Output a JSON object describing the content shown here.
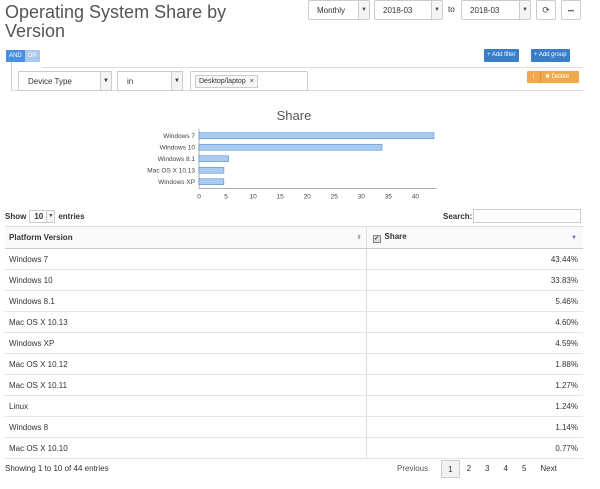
{
  "page": {
    "title": "Operating System Share by Version"
  },
  "controls": {
    "period": "Monthly",
    "from_date": "2018-03",
    "to_label": "to",
    "to_date": "2018-03",
    "refresh_icon": "refresh-icon",
    "more_icon": "ellipsis-icon",
    "more_label": "•••"
  },
  "filters": {
    "and_label": "AND",
    "or_label": "OR",
    "add_filter": "+ Add filter",
    "add_group": "+ Add group",
    "delete_label": "✖ Delete",
    "info_icon": "i",
    "field": "Device Type",
    "operator": "in",
    "value": "Desktop/laptop",
    "remove_x": "×"
  },
  "chart_data": {
    "type": "bar",
    "orientation": "horizontal",
    "title": "Share",
    "categories": [
      "Windows 7",
      "Windows 10",
      "Windows 8.1",
      "Mac OS X 10.13",
      "Windows XP"
    ],
    "values": [
      43.44,
      33.83,
      5.46,
      4.6,
      4.59
    ],
    "xlim": [
      0,
      44
    ],
    "xticks": [
      0,
      5,
      10,
      15,
      20,
      25,
      30,
      35,
      40
    ],
    "bar_color": "#a9cbf0",
    "bar_stroke": "#5a8fd0",
    "grid": false
  },
  "table": {
    "show_label": "Show",
    "page_size": "10",
    "entries_label": "entries",
    "search_label": "Search:",
    "columns": [
      "Platform Version",
      "Share"
    ],
    "check_mark": "✓",
    "rows": [
      {
        "name": "Windows 7",
        "share": "43.44%"
      },
      {
        "name": "Windows 10",
        "share": "33.83%"
      },
      {
        "name": "Windows 8.1",
        "share": "5.46%"
      },
      {
        "name": "Mac OS X 10.13",
        "share": "4.60%"
      },
      {
        "name": "Windows XP",
        "share": "4.59%"
      },
      {
        "name": "Mac OS X 10.12",
        "share": "1.88%"
      },
      {
        "name": "Mac OS X 10.11",
        "share": "1.27%"
      },
      {
        "name": "Linux",
        "share": "1.24%"
      },
      {
        "name": "Windows 8",
        "share": "1.14%"
      },
      {
        "name": "Mac OS X 10.10",
        "share": "0.77%"
      }
    ],
    "info": "Showing 1 to 10 of 44 entries"
  },
  "pagination": {
    "previous": "Previous",
    "pages": [
      "1",
      "2",
      "3",
      "4",
      "5"
    ],
    "current": "1",
    "next": "Next"
  }
}
